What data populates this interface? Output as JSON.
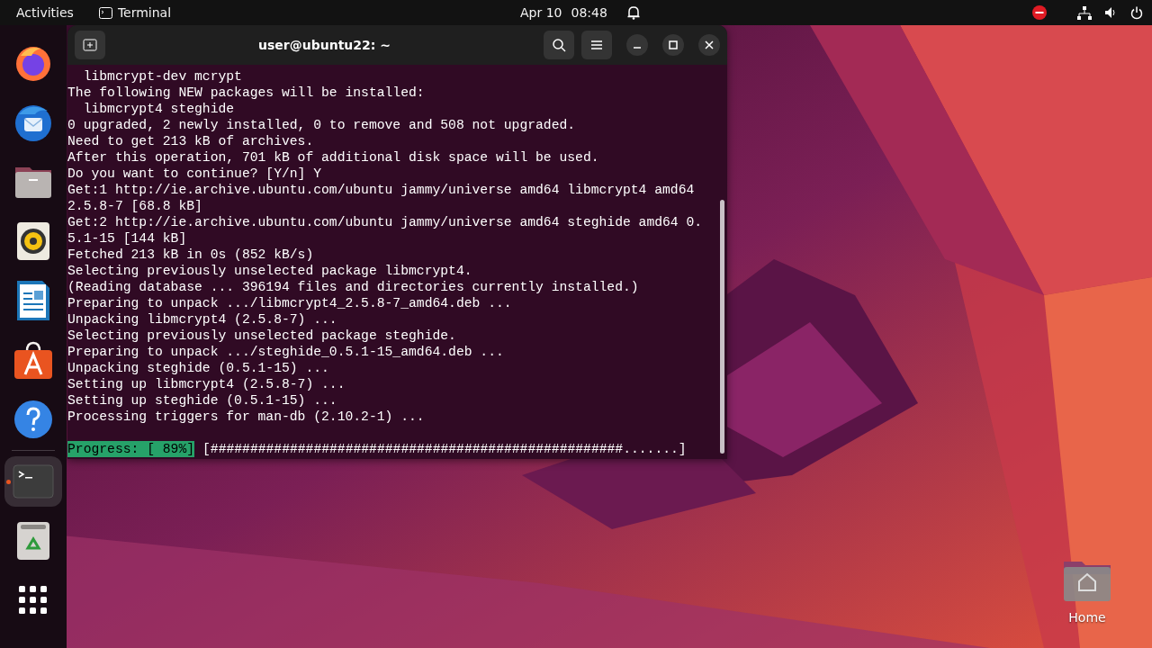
{
  "top_bar": {
    "activities": "Activities",
    "app_name": "Terminal",
    "date": "Apr 10",
    "time": "08:48"
  },
  "dock": [
    {
      "kind": "firefox",
      "active": false
    },
    {
      "kind": "thunderbird",
      "active": false
    },
    {
      "kind": "files",
      "active": false
    },
    {
      "kind": "rhythmbox",
      "active": false
    },
    {
      "kind": "writer",
      "active": false
    },
    {
      "kind": "appstore",
      "active": false
    },
    {
      "kind": "help",
      "active": false
    },
    {
      "kind": "separator"
    },
    {
      "kind": "terminal",
      "active": true
    },
    {
      "kind": "trash",
      "active": false
    },
    {
      "kind": "appgrid",
      "active": false
    }
  ],
  "window": {
    "title": "user@ubuntu22: ~",
    "lines": [
      "  libmcrypt-dev mcrypt",
      "The following NEW packages will be installed:",
      "  libmcrypt4 steghide",
      "0 upgraded, 2 newly installed, 0 to remove and 508 not upgraded.",
      "Need to get 213 kB of archives.",
      "After this operation, 701 kB of additional disk space will be used.",
      "Do you want to continue? [Y/n] Y",
      "Get:1 http://ie.archive.ubuntu.com/ubuntu jammy/universe amd64 libmcrypt4 amd64",
      "2.5.8-7 [68.8 kB]",
      "Get:2 http://ie.archive.ubuntu.com/ubuntu jammy/universe amd64 steghide amd64 0.",
      "5.1-15 [144 kB]",
      "Fetched 213 kB in 0s (852 kB/s)",
      "Selecting previously unselected package libmcrypt4.",
      "(Reading database ... 396194 files and directories currently installed.)",
      "Preparing to unpack .../libmcrypt4_2.5.8-7_amd64.deb ...",
      "Unpacking libmcrypt4 (2.5.8-7) ...",
      "Selecting previously unselected package steghide.",
      "Preparing to unpack .../steghide_0.5.1-15_amd64.deb ...",
      "Unpacking steghide (0.5.1-15) ...",
      "Setting up libmcrypt4 (2.5.8-7) ...",
      "Setting up steghide (0.5.1-15) ...",
      "Processing triggers for man-db (2.10.2-1) ..."
    ],
    "progress": {
      "label": "Progress: [ 89%]",
      "bar": "[####################################################.......]"
    }
  },
  "desktop_icons": [
    {
      "label": "Home"
    }
  ]
}
